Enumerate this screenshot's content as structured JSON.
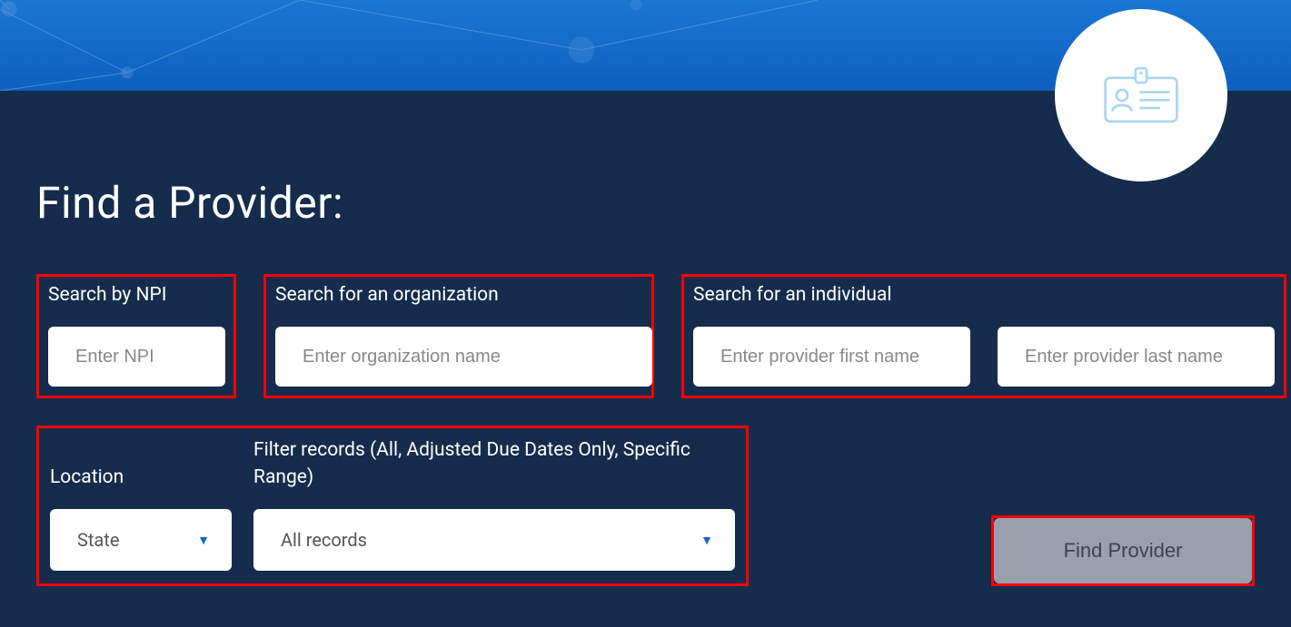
{
  "page_title": "Find a Provider:",
  "sections": {
    "npi": {
      "label": "Search by NPI",
      "placeholder": "Enter NPI"
    },
    "org": {
      "label": "Search for an organization",
      "placeholder": "Enter organization name"
    },
    "individual": {
      "label": "Search for an individual",
      "first_placeholder": "Enter provider first name",
      "last_placeholder": "Enter provider last name"
    },
    "location": {
      "label": "Location",
      "selected": "State"
    },
    "filter": {
      "label": "Filter records (All, Adjusted Due Dates Only, Specific Range)",
      "selected": "All records"
    }
  },
  "button": {
    "find": "Find Provider"
  }
}
